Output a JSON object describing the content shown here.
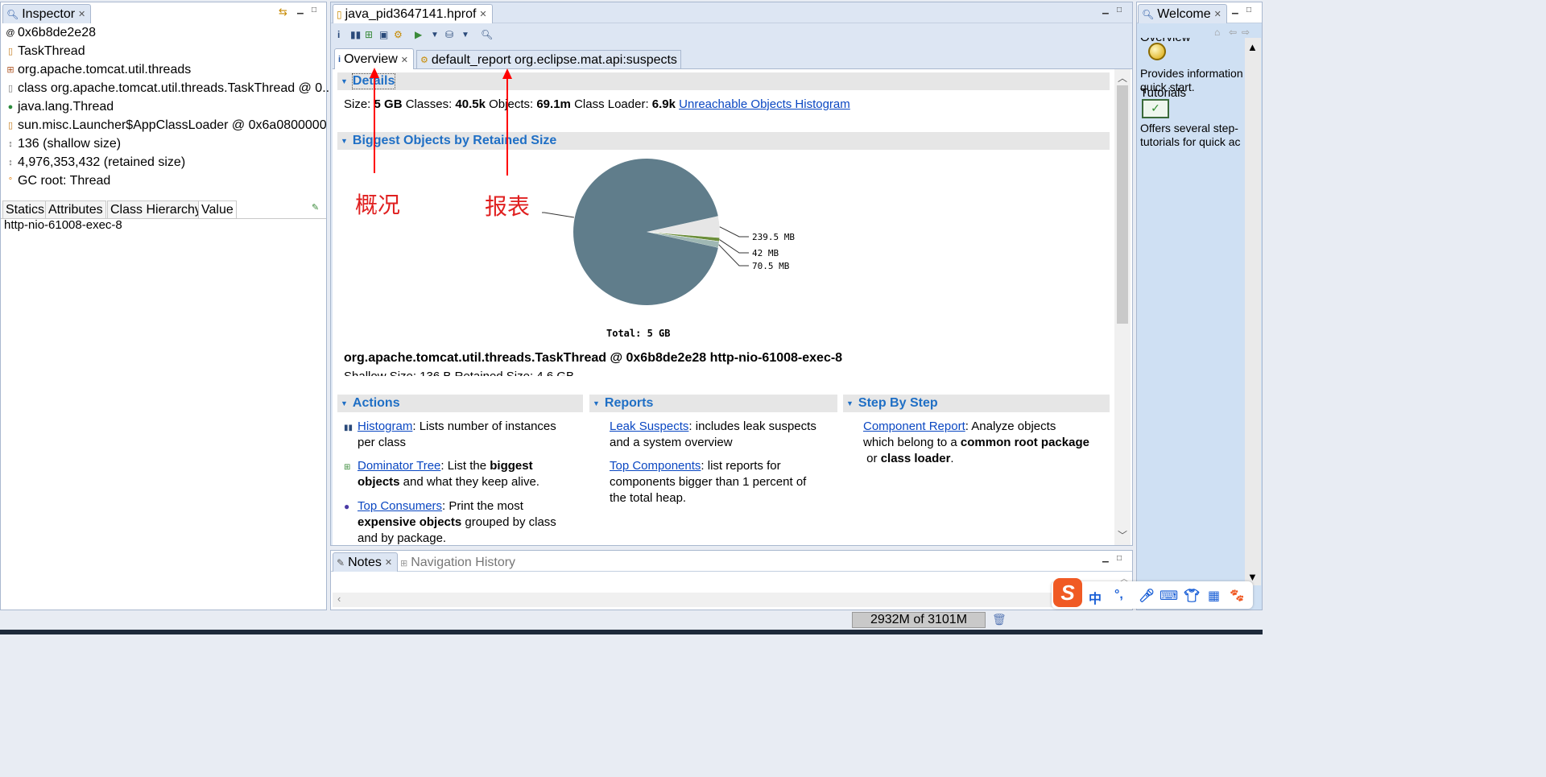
{
  "inspector": {
    "title": "Inspector",
    "rows": [
      {
        "icon": "address-icon",
        "text": "0x6b8de2e28"
      },
      {
        "icon": "class-icon",
        "text": "TaskThread"
      },
      {
        "icon": "package-icon",
        "text": "org.apache.tomcat.util.threads"
      },
      {
        "icon": "class-icon",
        "text": "class org.apache.tomcat.util.threads.TaskThread @ 0..."
      },
      {
        "icon": "thread-icon",
        "text": "java.lang.Thread"
      },
      {
        "icon": "classloader-icon",
        "text": "sun.misc.Launcher$AppClassLoader @ 0x6a0800000"
      },
      {
        "icon": "size-icon",
        "text": "136 (shallow size)"
      },
      {
        "icon": "size-icon",
        "text": "4,976,353,432 (retained size)"
      },
      {
        "icon": "gc-icon",
        "text": "GC root: Thread"
      }
    ],
    "subtabs": [
      "Statics",
      "Attributes",
      "Class Hierarchy",
      "Value"
    ],
    "active_subtab": "Value",
    "value_text": "http-nio-61008-exec-8"
  },
  "editor": {
    "file_tab": "java_pid3647141.hprof",
    "inner_tabs": [
      {
        "label": "Overview",
        "active": true
      },
      {
        "label": "default_report  org.eclipse.mat.api:suspects",
        "active": false
      }
    ],
    "details": {
      "header": "Details",
      "size_label": "Size:",
      "size_value": "5 GB",
      "classes_label": "Classes:",
      "classes_value": "40.5k",
      "objects_label": "Objects:",
      "objects_value": "69.1m",
      "loader_label": "Class Loader:",
      "loader_value": "6.9k",
      "unreachable_link": "Unreachable Objects Histogram"
    },
    "biggest_header": "Biggest Objects by Retained Size",
    "selected_object": "org.apache.tomcat.util.threads.TaskThread @ 0x6b8de2e28 http-nio-61008-exec-8",
    "selected_object_sub": "Shallow Size: 136 B  Retained Size: 4.6 GB",
    "annotations": {
      "overview_cn": "概况",
      "report_cn": "报表"
    },
    "actions": {
      "header": "Actions",
      "items": [
        {
          "link": "Histogram",
          "text1": ": Lists number of instances",
          "text2": "per class"
        },
        {
          "link": "Dominator Tree",
          "pre": ": List the ",
          "bold": "biggest",
          "bold2": "objects",
          "post": " and what they keep alive."
        },
        {
          "link": "Top Consumers",
          "pre": ": Print the most",
          "bold": "expensive objects",
          "post": " grouped by class",
          "line3": "and by package."
        }
      ]
    },
    "reports": {
      "header": "Reports",
      "items": [
        {
          "link": "Leak Suspects",
          "text1": ": includes leak suspects",
          "text2": "and a system overview"
        },
        {
          "link": "Top Components",
          "text1": ": list reports for",
          "text2": "components bigger than 1 percent of",
          "text3": "the total heap."
        }
      ]
    },
    "stepbystep": {
      "header": "Step By Step",
      "link": "Component Report",
      "text1": ": Analyze objects",
      "text2_pre": "which belong to a ",
      "text2_bold": "common root package",
      "text3_pre": " or ",
      "text3_bold": "class loader",
      "text3_post": "."
    }
  },
  "chart_data": {
    "type": "pie",
    "slices": [
      {
        "label": "4.6 GB",
        "value": 4.6,
        "unit": "GB",
        "color": "#607d8b"
      },
      {
        "label": "239.5 MB",
        "value": 0.2339,
        "unit": "GB",
        "color": "#e6e6e6"
      },
      {
        "label": "42 MB",
        "value": 0.041,
        "unit": "GB",
        "color": "#6b8e3a"
      },
      {
        "label": "70.5 MB",
        "value": 0.0688,
        "unit": "GB",
        "color": "#9fb8b4"
      }
    ],
    "total_label": "Total: 5 GB"
  },
  "welcome": {
    "title": "Welcome",
    "overview_heading": "Overview",
    "overview_text1": "Provides information",
    "overview_text2": "quick start.",
    "tutorials_heading": "Tutorials",
    "tutorials_text1": "Offers several step-",
    "tutorials_text2": "tutorials for quick ac"
  },
  "bottom": {
    "notes_tab": "Notes",
    "nav_tab": "Navigation History",
    "heap_status": "2932M of 3101M"
  },
  "ime": {
    "lang": "中",
    "punct": "°,"
  },
  "colors": {
    "accent": "#1f6fc5",
    "link": "#0a47c2",
    "arrow": "#ff0000",
    "pie_main": "#607d8b"
  }
}
